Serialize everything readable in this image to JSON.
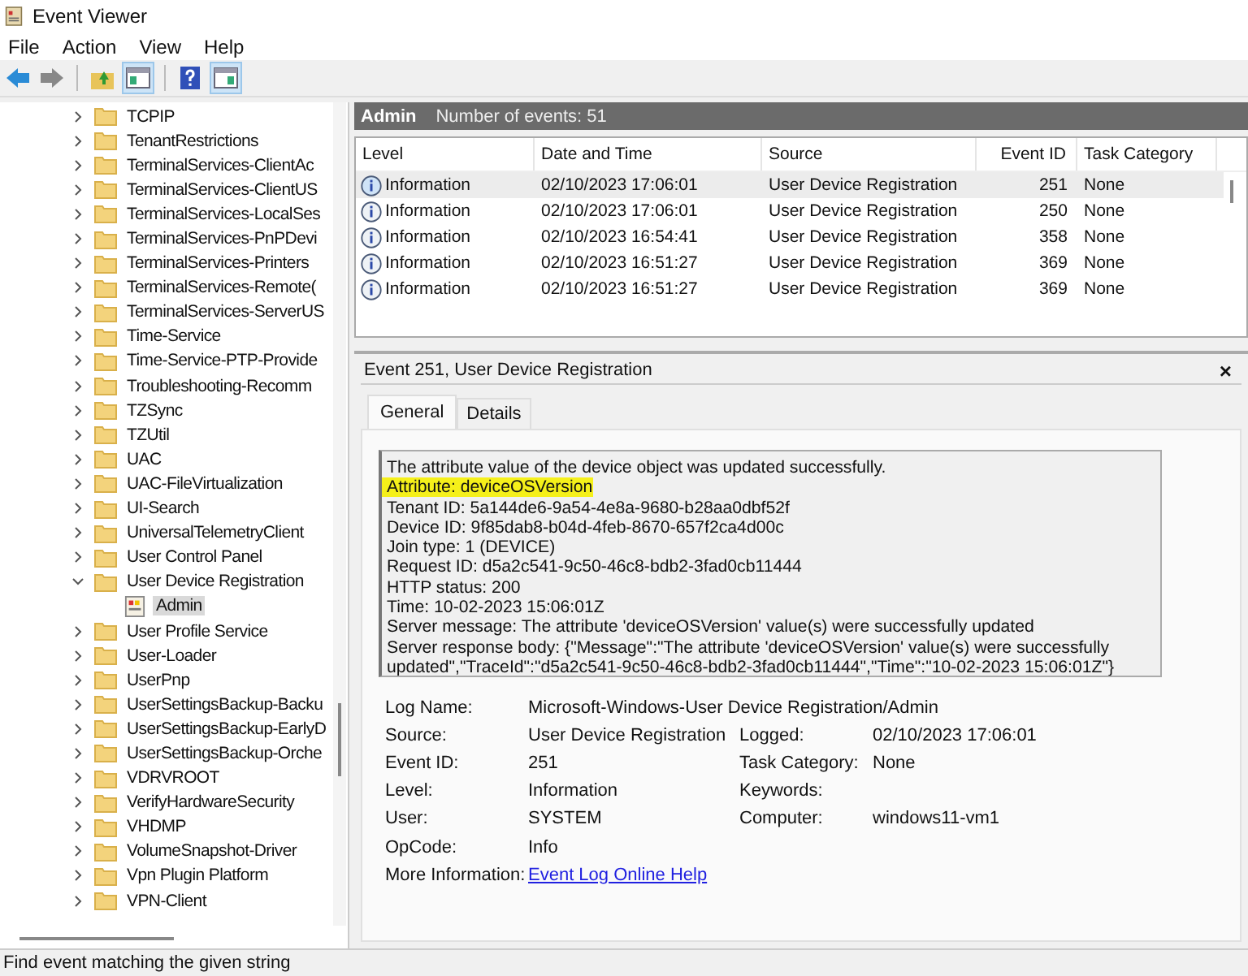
{
  "window": {
    "title": "Event Viewer"
  },
  "menu": [
    "File",
    "Action",
    "View",
    "Help"
  ],
  "tree": [
    {
      "label": "TCPIP",
      "expanded": false,
      "selected": false
    },
    {
      "label": "TenantRestrictions",
      "expanded": false,
      "selected": false
    },
    {
      "label": "TerminalServices-ClientAc",
      "expanded": false,
      "selected": false
    },
    {
      "label": "TerminalServices-ClientUS",
      "expanded": false,
      "selected": false
    },
    {
      "label": "TerminalServices-LocalSes",
      "expanded": false,
      "selected": false
    },
    {
      "label": "TerminalServices-PnPDevi",
      "expanded": false,
      "selected": false
    },
    {
      "label": "TerminalServices-Printers",
      "expanded": false,
      "selected": false
    },
    {
      "label": "TerminalServices-Remote(",
      "expanded": false,
      "selected": false
    },
    {
      "label": "TerminalServices-ServerUS",
      "expanded": false,
      "selected": false
    },
    {
      "label": "Time-Service",
      "expanded": false,
      "selected": false
    },
    {
      "label": "Time-Service-PTP-Provide",
      "expanded": false,
      "selected": false
    },
    {
      "label": "Troubleshooting-Recomm",
      "expanded": false,
      "selected": false
    },
    {
      "label": "TZSync",
      "expanded": false,
      "selected": false
    },
    {
      "label": "TZUtil",
      "expanded": false,
      "selected": false
    },
    {
      "label": "UAC",
      "expanded": false,
      "selected": false
    },
    {
      "label": "UAC-FileVirtualization",
      "expanded": false,
      "selected": false
    },
    {
      "label": "UI-Search",
      "expanded": false,
      "selected": false
    },
    {
      "label": "UniversalTelemetryClient",
      "expanded": false,
      "selected": false
    },
    {
      "label": "User Control Panel",
      "expanded": false,
      "selected": false
    },
    {
      "label": "User Device Registration",
      "expanded": true,
      "selected": false,
      "children": [
        {
          "label": "Admin",
          "kind": "log",
          "selected": true
        }
      ]
    },
    {
      "label": "User Profile Service",
      "expanded": false,
      "selected": false
    },
    {
      "label": "User-Loader",
      "expanded": false,
      "selected": false
    },
    {
      "label": "UserPnp",
      "expanded": false,
      "selected": false
    },
    {
      "label": "UserSettingsBackup-Backu",
      "expanded": false,
      "selected": false
    },
    {
      "label": "UserSettingsBackup-EarlyD",
      "expanded": false,
      "selected": false
    },
    {
      "label": "UserSettingsBackup-Orche",
      "expanded": false,
      "selected": false
    },
    {
      "label": "VDRVROOT",
      "expanded": false,
      "selected": false
    },
    {
      "label": "VerifyHardwareSecurity",
      "expanded": false,
      "selected": false
    },
    {
      "label": "VHDMP",
      "expanded": false,
      "selected": false
    },
    {
      "label": "VolumeSnapshot-Driver",
      "expanded": false,
      "selected": false
    },
    {
      "label": "Vpn Plugin Platform",
      "expanded": false,
      "selected": false
    },
    {
      "label": "VPN-Client",
      "expanded": false,
      "selected": false
    }
  ],
  "log_header": {
    "title": "Admin",
    "count": "Number of events: 51"
  },
  "table": {
    "columns": [
      "Level",
      "Date and Time",
      "Source",
      "Event ID",
      "Task Category"
    ],
    "rows": [
      {
        "level": "Information",
        "date": "02/10/2023 17:06:01",
        "source": "User Device Registration",
        "event_id": "251",
        "task": "None",
        "selected": true
      },
      {
        "level": "Information",
        "date": "02/10/2023 17:06:01",
        "source": "User Device Registration",
        "event_id": "250",
        "task": "None",
        "selected": false
      },
      {
        "level": "Information",
        "date": "02/10/2023 16:54:41",
        "source": "User Device Registration",
        "event_id": "358",
        "task": "None",
        "selected": false
      },
      {
        "level": "Information",
        "date": "02/10/2023 16:51:27",
        "source": "User Device Registration",
        "event_id": "369",
        "task": "None",
        "selected": false
      },
      {
        "level": "Information",
        "date": "02/10/2023 16:51:27",
        "source": "User Device Registration",
        "event_id": "369",
        "task": "None",
        "selected": false
      }
    ]
  },
  "detail": {
    "title": "Event 251, User Device Registration",
    "close": "×",
    "tabs": [
      {
        "label": "General",
        "selected": true
      },
      {
        "label": "Details",
        "selected": false
      }
    ],
    "message": [
      {
        "text": "The attribute value of the device object was updated successfully.",
        "highlighted": false
      },
      {
        "text": "Attribute: deviceOSVersion",
        "highlighted": true
      },
      {
        "text": "Tenant ID: 5a144de6-9a54-4e8a-9680-b28aa0dbf52f",
        "highlighted": false
      },
      {
        "text": "Device ID: 9f85dab8-b04d-4feb-8670-657f2ca4d00c",
        "highlighted": false
      },
      {
        "text": "Join type: 1 (DEVICE)",
        "highlighted": false
      },
      {
        "text": "Request ID: d5a2c541-9c50-46c8-bdb2-3fad0cb11444",
        "highlighted": false
      },
      {
        "text": "HTTP status: 200",
        "highlighted": false
      },
      {
        "text": "Time: 10-02-2023 15:06:01Z",
        "highlighted": false
      },
      {
        "text": "Server message: The attribute 'deviceOSVersion' value(s) were successfully updated",
        "highlighted": false
      },
      {
        "text": "Server response body: {\"Message\":\"The attribute 'deviceOSVersion' value(s) were successfully updated\",\"TraceId\":\"d5a2c541-9c50-46c8-bdb2-3fad0cb11444\",\"Time\":\"10-02-2023 15:06:01Z\"}",
        "highlighted": false
      }
    ],
    "fields": [
      [
        {
          "label": "Log Name:",
          "value": "Microsoft-Windows-User Device Registration/Admin",
          "kind": "text"
        }
      ],
      [
        {
          "label": "Source:",
          "value": "User Device Registration",
          "kind": "text"
        },
        {
          "label": "Logged:",
          "value": "02/10/2023 17:06:01",
          "kind": "text"
        }
      ],
      [
        {
          "label": "Event ID:",
          "value": "251",
          "kind": "text"
        },
        {
          "label": "Task Category:",
          "value": "None",
          "kind": "text"
        }
      ],
      [
        {
          "label": "Level:",
          "value": "Information",
          "kind": "text"
        },
        {
          "label": "Keywords:"
        }
      ],
      [
        {
          "label": "User:",
          "value": "SYSTEM",
          "kind": "text"
        },
        {
          "label": "Computer:",
          "value": "windows11-vm1",
          "kind": "text"
        }
      ],
      [
        {
          "label": "OpCode:",
          "value": "Info",
          "kind": "text"
        }
      ],
      [
        {
          "label": "More Information:",
          "value": "Event Log Online Help",
          "kind": "link"
        }
      ]
    ]
  },
  "status_bar": "Find event matching the given string"
}
